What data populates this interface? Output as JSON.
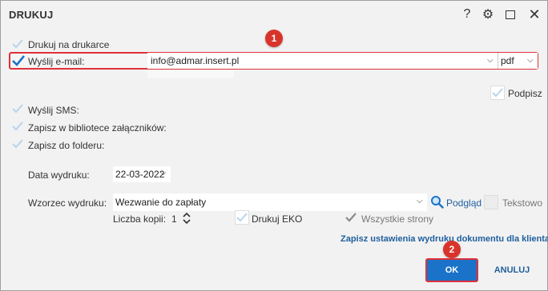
{
  "title": "DRUKUJ",
  "titlebar": {
    "help": "?",
    "settings": "⚙",
    "close": "✕"
  },
  "options": {
    "print": "Drukuj na drukarce",
    "email": "Wyślij e-mail:",
    "sms": "Wyślij SMS:",
    "library": "Zapisz w bibliotece załączników:",
    "folder": "Zapisz do folderu:",
    "sign": "Podpisz"
  },
  "email": {
    "address": "info@admar.insert.pl",
    "format": "pdf"
  },
  "print_date": {
    "label": "Data wydruku:",
    "value": "22-03-2022"
  },
  "template": {
    "label": "Wzorzec wydruku:",
    "value": "Wezwanie do zapłaty",
    "preview": "Podgląd",
    "text": "Tekstowo"
  },
  "copies": {
    "label": "Liczba kopii:",
    "value": "1"
  },
  "eco": "Drukuj EKO",
  "all_pages": "Wszystkie strony",
  "save_settings_link": "Zapisz ustawienia wydruku dokumentu dla klienta",
  "buttons": {
    "ok": "OK",
    "cancel": "ANULUJ"
  },
  "badges": {
    "one": "1",
    "two": "2"
  },
  "colors": {
    "accent": "#1a73c9",
    "highlight": "#e0313a",
    "badge": "#d9342b",
    "link": "#1f5f9e"
  }
}
